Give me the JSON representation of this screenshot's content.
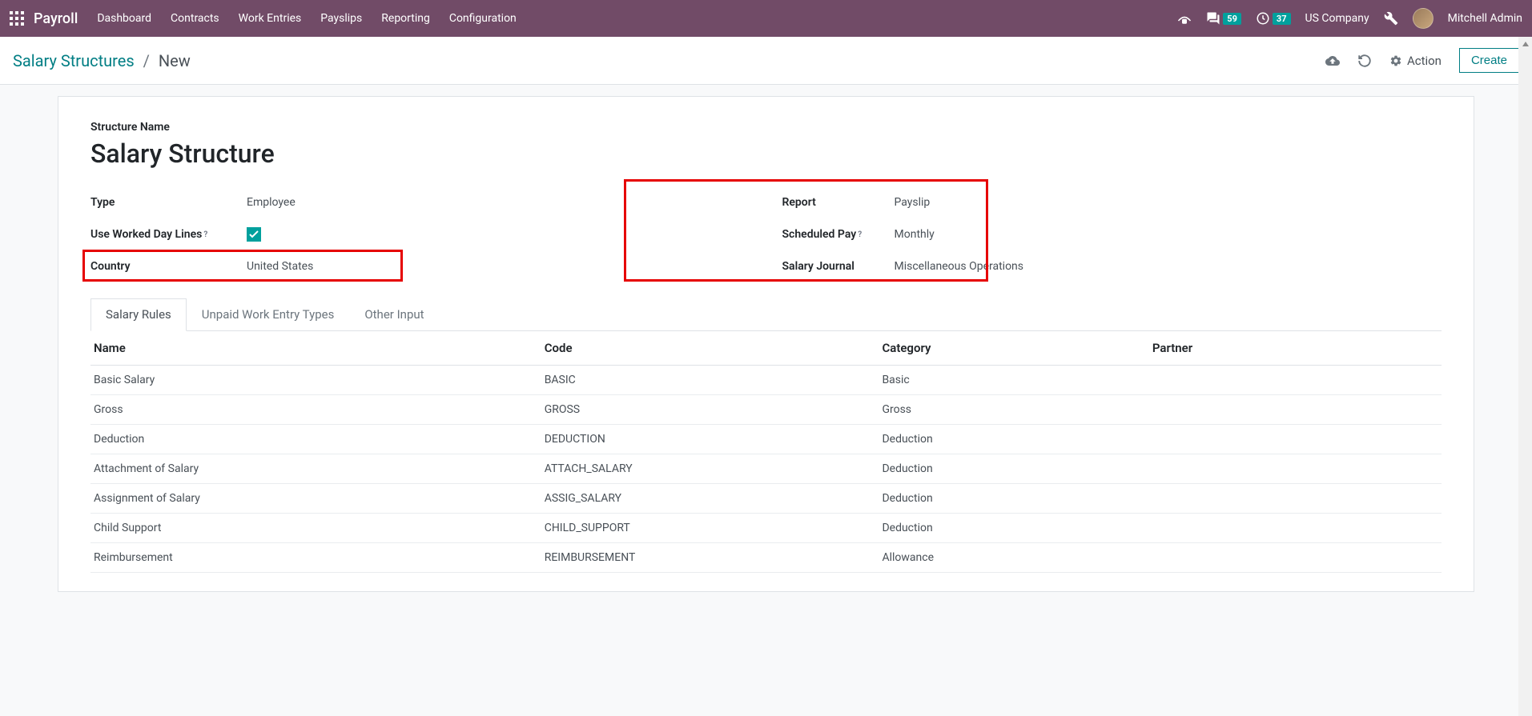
{
  "navbar": {
    "app_title": "Payroll",
    "menu": [
      "Dashboard",
      "Contracts",
      "Work Entries",
      "Payslips",
      "Reporting",
      "Configuration"
    ],
    "messages_badge": "59",
    "activities_badge": "37",
    "company": "US Company",
    "user": "Mitchell Admin"
  },
  "control_panel": {
    "breadcrumb_parent": "Salary Structures",
    "breadcrumb_current": "New",
    "action_label": "Action",
    "create_label": "Create"
  },
  "form": {
    "structure_name_label": "Structure Name",
    "record_title": "Salary Structure",
    "left": {
      "type_label": "Type",
      "type_value": "Employee",
      "worked_day_label": "Use Worked Day Lines",
      "country_label": "Country",
      "country_value": "United States"
    },
    "right": {
      "report_label": "Report",
      "report_value": "Payslip",
      "scheduled_label": "Scheduled Pay",
      "scheduled_value": "Monthly",
      "journal_label": "Salary Journal",
      "journal_value": "Miscellaneous Operations"
    }
  },
  "tabs": [
    "Salary Rules",
    "Unpaid Work Entry Types",
    "Other Input"
  ],
  "table": {
    "headers": [
      "Name",
      "Code",
      "Category",
      "Partner"
    ],
    "rows": [
      {
        "name": "Basic Salary",
        "code": "BASIC",
        "category": "Basic",
        "partner": ""
      },
      {
        "name": "Gross",
        "code": "GROSS",
        "category": "Gross",
        "partner": ""
      },
      {
        "name": "Deduction",
        "code": "DEDUCTION",
        "category": "Deduction",
        "partner": ""
      },
      {
        "name": "Attachment of Salary",
        "code": "ATTACH_SALARY",
        "category": "Deduction",
        "partner": ""
      },
      {
        "name": "Assignment of Salary",
        "code": "ASSIG_SALARY",
        "category": "Deduction",
        "partner": ""
      },
      {
        "name": "Child Support",
        "code": "CHILD_SUPPORT",
        "category": "Deduction",
        "partner": ""
      },
      {
        "name": "Reimbursement",
        "code": "REIMBURSEMENT",
        "category": "Allowance",
        "partner": ""
      }
    ]
  }
}
